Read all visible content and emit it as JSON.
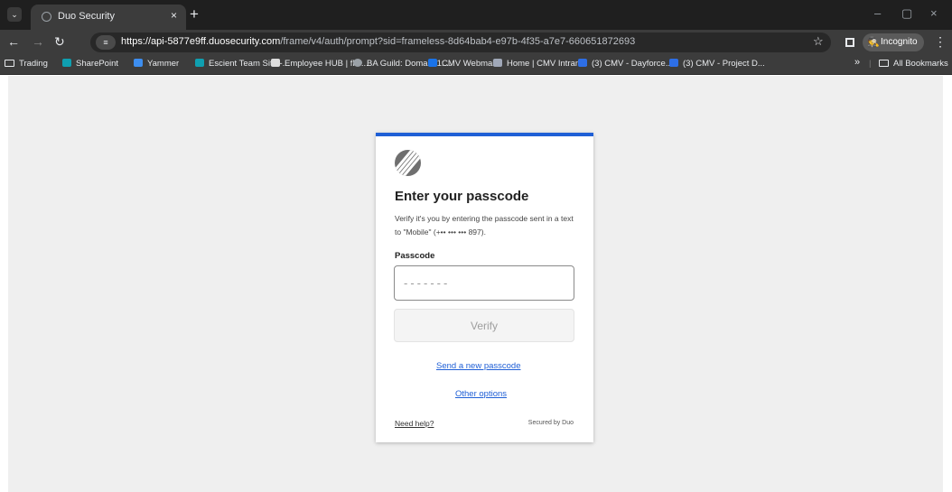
{
  "browser": {
    "tab_title": "Duo Security",
    "tab_close": "×",
    "new_tab": "+",
    "tab_search_icon": "chevron-down",
    "url_domain": "https://api-5877e9ff.duosecurity.com",
    "url_path": "/frame/v4/auth/prompt?sid=frameless-8d64bab4-e97b-4f35-a7e7-660651872693",
    "incognito_label": "Incognito",
    "window_controls": [
      "–",
      "▢",
      "×"
    ]
  },
  "bookmarks": {
    "items": [
      {
        "label": "Trading",
        "icon": "folder-icon",
        "color": ""
      },
      {
        "label": "SharePoint",
        "icon": "sharepoint-icon",
        "color": "#0f9fb0"
      },
      {
        "label": "Yammer",
        "icon": "yammer-icon",
        "color": "#3d8ef0"
      },
      {
        "label": "Escient Team Site -...",
        "icon": "sharepoint-icon",
        "color": "#0f9fb0"
      },
      {
        "label": "Employee HUB | flai...",
        "icon": "hub-icon",
        "color": "#dddddd"
      },
      {
        "label": "BA Guild: Domain 1:...",
        "icon": "globe-icon",
        "color": "#9aa0a6"
      },
      {
        "label": "CMV Webmail",
        "icon": "outlook-icon",
        "color": "#1a73e8"
      },
      {
        "label": "Home | CMV Intranet",
        "icon": "intranet-icon",
        "color": "#a0a8b8"
      },
      {
        "label": "(3) CMV - Dayforce...",
        "icon": "dayforce-icon",
        "color": "#2d6ee6"
      },
      {
        "label": "(3) CMV - Project D...",
        "icon": "dayforce-icon",
        "color": "#2d6ee6"
      }
    ],
    "overflow": "»",
    "all_bookmarks": "All Bookmarks"
  },
  "auth": {
    "title": "Enter your passcode",
    "description": "Verify it's you by entering the passcode sent in a text to \"Mobile\" (+•• ••• ••• 897).",
    "passcode_label": "Passcode",
    "passcode_placeholder": "-------",
    "verify_label": "Verify",
    "resend_link": "Send a new passcode",
    "other_options_link": "Other options",
    "help_link": "Need help?",
    "secured_by": "Secured by Duo",
    "accent_color": "#1f5fd6"
  }
}
